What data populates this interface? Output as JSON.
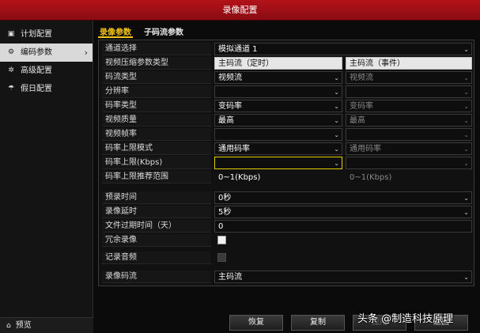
{
  "window": {
    "title": "录像配置"
  },
  "sidebar": {
    "items": [
      {
        "label": "计划配置",
        "icon": "calendar-icon"
      },
      {
        "label": "编码参数",
        "icon": "gear-icon",
        "active": true
      },
      {
        "label": "高级配置",
        "icon": "settings-icon"
      },
      {
        "label": "假日配置",
        "icon": "umbrella-icon"
      }
    ],
    "preview": {
      "label": "预览",
      "icon": "home-icon"
    }
  },
  "tabs": [
    {
      "label": "录像参数",
      "active": true
    },
    {
      "label": "子码流参数",
      "active": false
    }
  ],
  "form": {
    "channel": {
      "label": "通道选择",
      "value": "模拟通道 1"
    },
    "compress_type": {
      "label": "视频压缩参数类型",
      "col1": "主码流（定时）",
      "col2": "主码流（事件）"
    },
    "stream_type": {
      "label": "码流类型",
      "col1": "视频流",
      "col2": "视频流"
    },
    "resolution": {
      "label": "分辨率",
      "col1": "",
      "col2": ""
    },
    "bitrate_type": {
      "label": "码率类型",
      "col1": "变码率",
      "col2": "变码率"
    },
    "video_quality": {
      "label": "视频质量",
      "col1": "最高",
      "col2": "最高"
    },
    "frame_rate": {
      "label": "视频帧率",
      "col1": "",
      "col2": ""
    },
    "bitrate_mode": {
      "label": "码率上限模式",
      "col1": "通用码率",
      "col2": "通用码率"
    },
    "bitrate_max": {
      "label": "码率上限(Kbps)",
      "col1": "",
      "col2": ""
    },
    "bitrate_range": {
      "label": "码率上限推荐范围",
      "col1": "0~1(Kbps)",
      "col2": "0~1(Kbps)"
    },
    "prerecord": {
      "label": "预录时间",
      "value": "0秒"
    },
    "postrecord": {
      "label": "录像延时",
      "value": "5秒"
    },
    "expire_days": {
      "label": "文件过期时间（天）",
      "value": "0"
    },
    "redundant": {
      "label": "冗余录像",
      "checked": false
    },
    "record_audio": {
      "label": "记录音频",
      "checked": false
    },
    "record_stream": {
      "label": "录像码流",
      "value": "主码流"
    }
  },
  "buttons": {
    "restore": "恢复",
    "copy": "复制",
    "apply": "应用",
    "back": "返回"
  },
  "watermark": {
    "text": "头条 @制造科技原理"
  }
}
